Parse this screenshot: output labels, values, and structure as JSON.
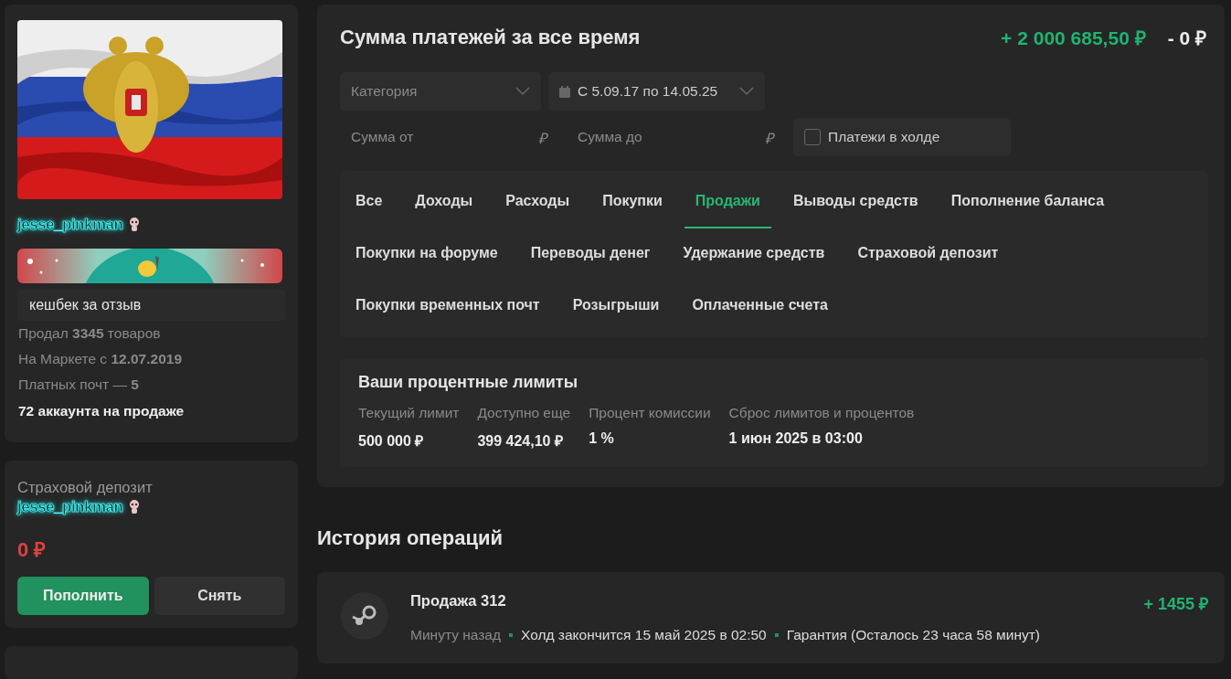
{
  "profile": {
    "username": "jesse_pinkman",
    "badge_text": "кешбек за отзыв",
    "stats": [
      {
        "text": "Продал **3345** товаров",
        "kind": "muted"
      },
      {
        "text": "На Маркете с **12.07.2019**",
        "kind": "muted"
      },
      {
        "text": "Платных почт — **5**",
        "kind": "muted"
      },
      {
        "text": "72 аккаунта на продаже",
        "kind": "strong"
      }
    ]
  },
  "deposit": {
    "title": "Страховой депозит",
    "username": "jesse_pinkman",
    "amount": "0 ₽",
    "buttons": [
      {
        "label": "Пополнить",
        "kind": "primary"
      },
      {
        "label": "Снять",
        "kind": "secondary"
      }
    ]
  },
  "summary": {
    "title": "Сумма платежей за все время",
    "income": "+ 2 000 685,50 ₽",
    "expense": "- 0 ₽",
    "category": {
      "placeholder": "Категория"
    },
    "date_range": {
      "value": "С 5.09.17 по 14.05.25"
    },
    "amount_from": {
      "placeholder": "Сумма от",
      "currency": "₽"
    },
    "amount_to": {
      "placeholder": "Сумма до",
      "currency": "₽"
    },
    "hold": {
      "label": "Платежи в холде",
      "checked": false
    },
    "tab_rows": [
      {
        "tabs": [
          {
            "label": "Все",
            "selected": false
          },
          {
            "label": "Доходы",
            "selected": false
          },
          {
            "label": "Расходы",
            "selected": false
          },
          {
            "label": "Покупки",
            "selected": false
          },
          {
            "label": "Продажи",
            "selected": true
          },
          {
            "label": "Выводы средств",
            "selected": false
          },
          {
            "label": "Пополнение баланса",
            "selected": false
          }
        ]
      },
      {
        "tabs": [
          {
            "label": "Покупки на форуме",
            "selected": false
          },
          {
            "label": "Переводы денег",
            "selected": false
          },
          {
            "label": "Удержание средств",
            "selected": false
          },
          {
            "label": "Страховой депозит",
            "selected": false
          }
        ]
      },
      {
        "tabs": [
          {
            "label": "Покупки временных почт",
            "selected": false
          },
          {
            "label": "Розыгрыши",
            "selected": false
          },
          {
            "label": "Оплаченные счета",
            "selected": false
          }
        ]
      }
    ],
    "limits": {
      "title": "Ваши процентные лимиты",
      "columns": [
        {
          "label": "Текущий лимит",
          "value": "500 000 ₽"
        },
        {
          "label": "Доступно еще",
          "value": "399 424,10 ₽"
        },
        {
          "label": "Процент комиссии",
          "value": "1 %"
        },
        {
          "label": "Сброс лимитов и процентов",
          "value": "1 июн 2025 в 03:00"
        }
      ]
    }
  },
  "history": {
    "title": "История операций",
    "operations": [
      {
        "title": "Продажа 312",
        "amount": "+ 1455 ₽",
        "time": "Минуту назад",
        "hold": "Холд закончится 15 май 2025 в 02:50",
        "guarantee": "Гарантия (Осталось 23 часа 58 минут)"
      }
    ]
  }
}
